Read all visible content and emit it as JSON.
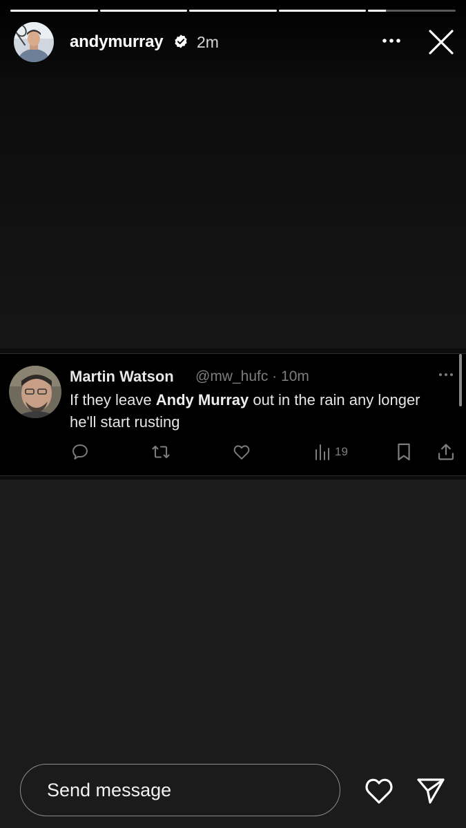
{
  "story": {
    "segments": [
      1,
      1,
      1,
      1,
      0.2
    ]
  },
  "header": {
    "username": "andymurray",
    "time_ago": "2m",
    "avatar_icon": "profile-avatar",
    "verified_icon": "verified-badge-icon",
    "more_icon": "more-dots-icon",
    "close_icon": "close-icon"
  },
  "tweet": {
    "author_name": "Martin Watson",
    "author_handle": "@mw_hufc · 10m",
    "text_before": "If they leave ",
    "text_bold": "Andy Murray",
    "text_after": " out in the rain any longer he'll start rusting",
    "actions": {
      "reply_icon": "reply-icon",
      "retweet_icon": "retweet-icon",
      "like_icon": "like-heart-icon",
      "views_icon": "views-chart-icon",
      "views_count": "19",
      "bookmark_icon": "bookmark-icon",
      "share_icon": "share-icon"
    }
  },
  "footer": {
    "message_placeholder": "Send message",
    "like_icon": "heart-icon",
    "send_icon": "send-icon"
  },
  "colors": {
    "background": "#1b1b1b",
    "tweet_background": "#000000",
    "muted_text": "#7d7d7d"
  }
}
